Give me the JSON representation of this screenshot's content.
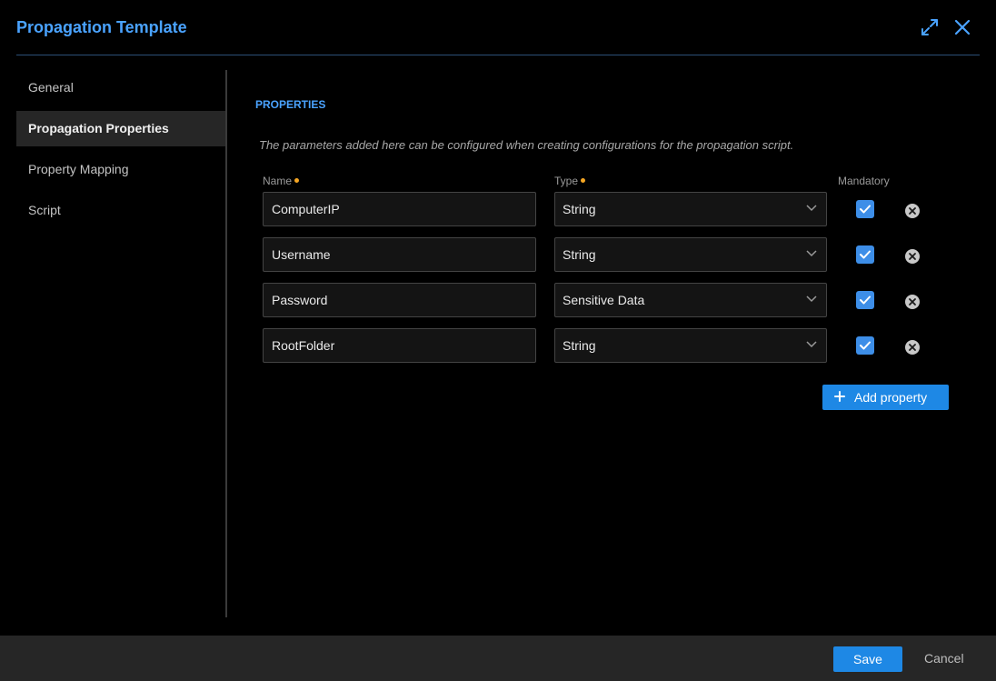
{
  "dialog": {
    "title": "Propagation Template",
    "expand_icon": "expand-arrows-icon",
    "close_icon": "close-icon"
  },
  "sidebar": {
    "items": [
      {
        "label": "General",
        "active": false
      },
      {
        "label": "Propagation Properties",
        "active": true
      },
      {
        "label": "Property Mapping",
        "active": false
      },
      {
        "label": "Script",
        "active": false
      }
    ]
  },
  "main": {
    "section_title": "PROPERTIES",
    "description": "The parameters added here can be configured when creating configurations for the propagation script.",
    "columns": {
      "name": "Name",
      "type": "Type",
      "mandatory": "Mandatory"
    },
    "properties": [
      {
        "name": "ComputerIP",
        "type": "String",
        "mandatory": true
      },
      {
        "name": "Username",
        "type": "String",
        "mandatory": true
      },
      {
        "name": "Password",
        "type": "Sensitive Data",
        "mandatory": true
      },
      {
        "name": "RootFolder",
        "type": "String",
        "mandatory": true
      }
    ],
    "add_button": "Add property"
  },
  "footer": {
    "save": "Save",
    "cancel": "Cancel"
  },
  "colors": {
    "accent": "#4aa3ff",
    "button": "#1e88e5",
    "required_dot": "#f5a623",
    "checkbox": "#3d8ee8"
  }
}
